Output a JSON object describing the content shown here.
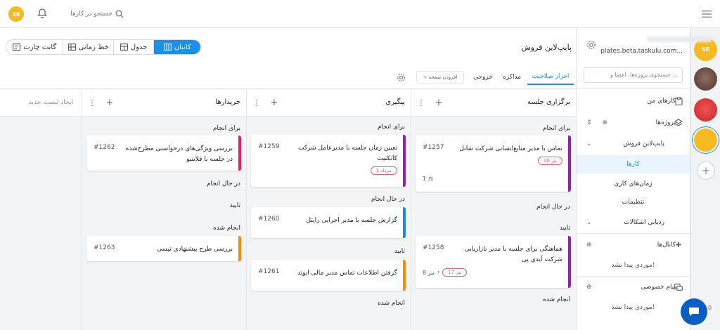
{
  "topbar": {
    "avatar_initials": "SE",
    "search_label": "جستجو در کارها"
  },
  "sidebar": {
    "workspace_url": "plates.beta.taskulu.com...",
    "search_placeholder": "جستجوی پروژه‌ها، اعضا و ...",
    "my_tasks": "کارهای من",
    "projects": "پروژه‌ها",
    "project_name": "پایپ‌لاین فروش",
    "sub_tasks": "کارها",
    "sub_worktime": "زمان‌های کاری",
    "sub_settings": "تنظیمات",
    "issue_tracking": "ردیابی اشکالات",
    "channels": "کانال‌ها",
    "channels_empty": "موردی پیدا نشد!",
    "private_messages": "پیام خصوصی",
    "pm_empty": "موردی پیدا نشد!"
  },
  "rail": {
    "workspace_colors": [
      "#f5b921",
      "#6d4c41",
      "#e53935",
      "#f5b921"
    ],
    "badge_count": "0"
  },
  "header": {
    "project_title": "پایپ‌لاین فروش",
    "views": {
      "kanban": "کانبان",
      "table": "جدول",
      "timeline": "خط زمانی",
      "gantt": "گانت چارت"
    },
    "tabs": [
      "احراز صلاحیت",
      "مذاکره",
      "خروجی"
    ],
    "add_page": "+ افزودن صفحه"
  },
  "board": {
    "new_list": "ایجاد لیست جدید",
    "columns": [
      {
        "title": "برگزاری جلسه",
        "s1": "برای انجام",
        "s2": "در حال انجام",
        "s3": "تایید",
        "s4": "انجام شده",
        "card1": {
          "text": "تماس با مدیر منابع‌انسانی شرکت شاتل",
          "id": "#1257",
          "badge": "20 تیر",
          "meta": "1"
        },
        "card2": {
          "text": "هماهنگی برای جلسه با مدیر بازاریابی شرکت آیدی پی",
          "id": "#1258",
          "badge": "17 تیر",
          "meta": "8 تیر"
        }
      },
      {
        "title": "پیگیری",
        "s1": "برای انجام",
        "s2": "در حال انجام",
        "s3": "تایید",
        "s4": "انجام شده",
        "card1": {
          "text": "تعیین زمان جلسه با مدیرعامل شرکت کانکتیت",
          "id": "#1259",
          "badge": "1 مرداد"
        },
        "card2": {
          "text": "گزارش جلسه با مدیر اجرایی رایتل",
          "id": "#1260"
        },
        "card3": {
          "text": "گرفتن اطلاعات تماس مدیر مالی ایوند",
          "id": "#1261"
        }
      },
      {
        "title": "خریدارها",
        "s1": "برای انجام",
        "s2": "در حال انجام",
        "s3": "تایید",
        "s4": "انجام شده",
        "card1": {
          "text": "بررسی ویژگی‌های درخواستی مطرح‌شده در جلسه با فلایتیو",
          "id": "#1262"
        },
        "card2": {
          "text": "بررسی طرح پیشنهادی تپسی",
          "id": "#1263"
        }
      }
    ]
  },
  "colors": {
    "accent": "#1e8fe6",
    "purple": "#8e24aa",
    "blue": "#1e88e5",
    "orange": "#fb8c00",
    "pink": "#e91e63",
    "badge_red": "#e4606d"
  }
}
